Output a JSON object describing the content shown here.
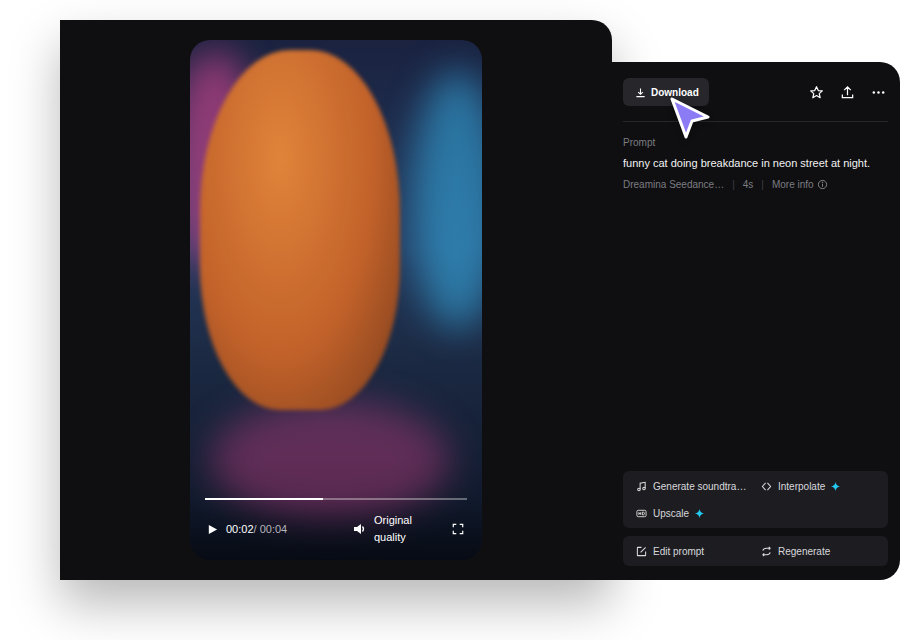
{
  "video": {
    "current_time": "00:02",
    "time_separator": "/",
    "duration": "00:04",
    "progress": 0.45,
    "playing": false,
    "quality": "Original quality"
  },
  "toolbar": {
    "download": "Download"
  },
  "prompt": {
    "label": "Prompt",
    "text": "funny cat doing breakdance in neon street at night.",
    "model": "Dreamina Seedance…",
    "meta_separator": "|",
    "length": "4s",
    "more_info": "More info"
  },
  "tools": [
    {
      "label": "Generate soundtra…",
      "kind": "soundtrack",
      "premium": false
    },
    {
      "label": "Interpolate",
      "kind": "interpolate",
      "premium": true
    },
    {
      "label": "Upscale",
      "kind": "upscale",
      "premium": true
    }
  ],
  "actions": [
    {
      "label": "Edit prompt",
      "kind": "edit"
    },
    {
      "label": "Regenerate",
      "kind": "regenerate"
    }
  ]
}
